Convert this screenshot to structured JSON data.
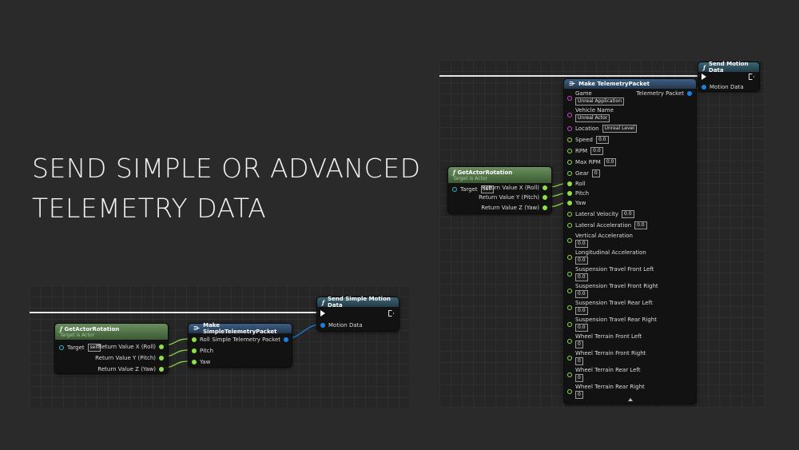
{
  "title": {
    "line1": "SEND SIMPLE OR ADVANCED",
    "line2": "TELEMETRY DATA"
  },
  "simple_graph": {
    "get_rotation": {
      "title": "GetActorRotation",
      "subtitle": "Target is Actor",
      "target_label": "Target",
      "target_value": "self",
      "outputs": [
        "Return Value X (Roll)",
        "Return Value Y (Pitch)",
        "Return Value Z (Yaw)"
      ]
    },
    "make_packet": {
      "title": "Make SimpleTelemetryPacket",
      "inputs": [
        "Roll",
        "Pitch",
        "Yaw"
      ],
      "output": "Simple Telemetry Packet"
    },
    "send": {
      "title": "Send Simple Motion Data",
      "input": "Motion Data"
    }
  },
  "advanced_graph": {
    "get_rotation": {
      "title": "GetActorRotation",
      "subtitle": "Target is Actor",
      "target_label": "Target",
      "target_value": "self",
      "outputs": [
        "Return Value X (Roll)",
        "Return Value Y (Pitch)",
        "Return Value Z (Yaw)"
      ]
    },
    "send": {
      "title": "Send Motion Data",
      "input": "Motion Data"
    },
    "make_packet": {
      "title": "Make TelemetryPacket",
      "output": "Telemetry Packet",
      "game_label": "Game",
      "game_value": "Unreal Application",
      "vehicle_label": "Vehicle Name",
      "vehicle_value": "Unreal Actor",
      "location_label": "Location",
      "location_value": "Unreal Level",
      "speed_label": "Speed",
      "speed_value": "0.0",
      "rpm_label": "RPM",
      "rpm_value": "0.0",
      "maxrpm_label": "Max RPM",
      "maxrpm_value": "0.0",
      "gear_label": "Gear",
      "gear_value": "0",
      "roll_label": "Roll",
      "pitch_label": "Pitch",
      "yaw_label": "Yaw",
      "latvel_label": "Lateral Velocity",
      "latvel_value": "0.0",
      "latacc_label": "Lateral Acceleration",
      "latacc_value": "0.0",
      "vertacc_label": "Vertical Acceleration",
      "vertacc_value": "0.0",
      "longacc_label": "Longitudinal Acceleration",
      "longacc_value": "0.0",
      "stfl_label": "Suspension Travel Front Left",
      "stfl_value": "0.0",
      "stfr_label": "Suspension Travel Front Right",
      "stfr_value": "0.0",
      "strl_label": "Suspension Travel Rear Left",
      "strl_value": "0.0",
      "strr_label": "Suspension Travel Rear Right",
      "strr_value": "0.0",
      "wtfl_label": "Wheel Terrain Front Left",
      "wtfl_value": "0",
      "wtfr_label": "Wheel Terrain Front Right",
      "wtfr_value": "0",
      "wtrl_label": "Wheel Terrain Rear Left",
      "wtrl_value": "0",
      "wtrr_label": "Wheel Terrain Rear Right",
      "wtrr_value": "0"
    }
  },
  "colors": {
    "float_pin": "#8ee04a",
    "struct_pin": "#1a7fe6",
    "string_pin": "#c84ac8",
    "rotator_pin": "#36b5c9"
  }
}
